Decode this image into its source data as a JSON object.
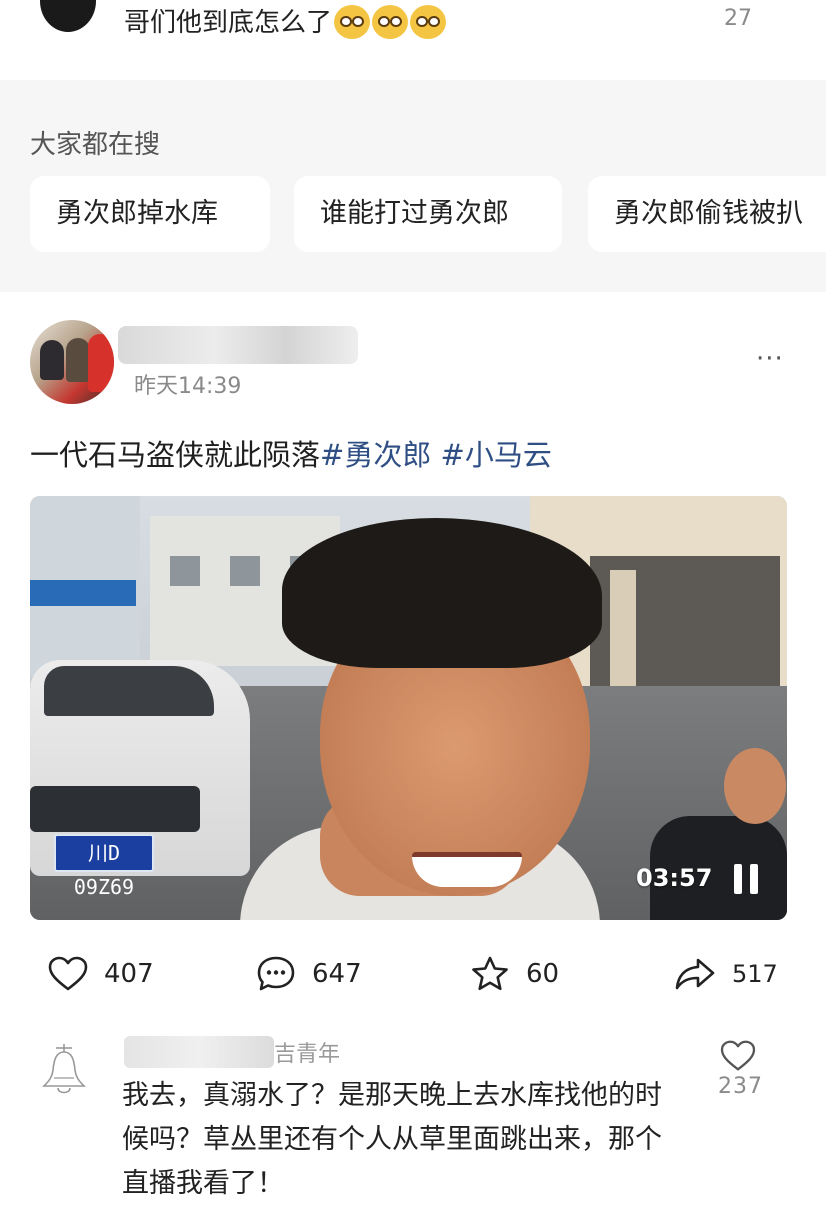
{
  "top_comment": {
    "text": "哥们他到底怎么了",
    "emoji_count": 3,
    "emoji_icon": "pleading-face-emoji",
    "like_count": "27"
  },
  "search_section": {
    "title": "大家都在搜",
    "chips": [
      {
        "label": "勇次郎掉水库"
      },
      {
        "label": "谁能打过勇次郎"
      },
      {
        "label": "勇次郎偷钱被扒"
      }
    ]
  },
  "post": {
    "time": "昨天14:39",
    "more_label": "···",
    "text_plain": "一代石马盗侠就此陨落",
    "hashtags": [
      "#勇次郎",
      "#小马云"
    ],
    "video": {
      "duration": "03:57",
      "plate": "川D 09Z69"
    },
    "actions": {
      "like_count": "407",
      "comment_count": "647",
      "favorite_count": "60",
      "share_count": "517"
    }
  },
  "comment": {
    "name_suffix": "吉青年",
    "text": "我去，真溺水了？是那天晚上去水库找他的时候吗？草丛里还有个人从草里面跳出来，那个直播我看了！",
    "like_count": "237"
  },
  "colors": {
    "hashtag": "#2f4f84",
    "section_bg": "#f6f6f6",
    "muted_text": "#8a8a8a"
  }
}
